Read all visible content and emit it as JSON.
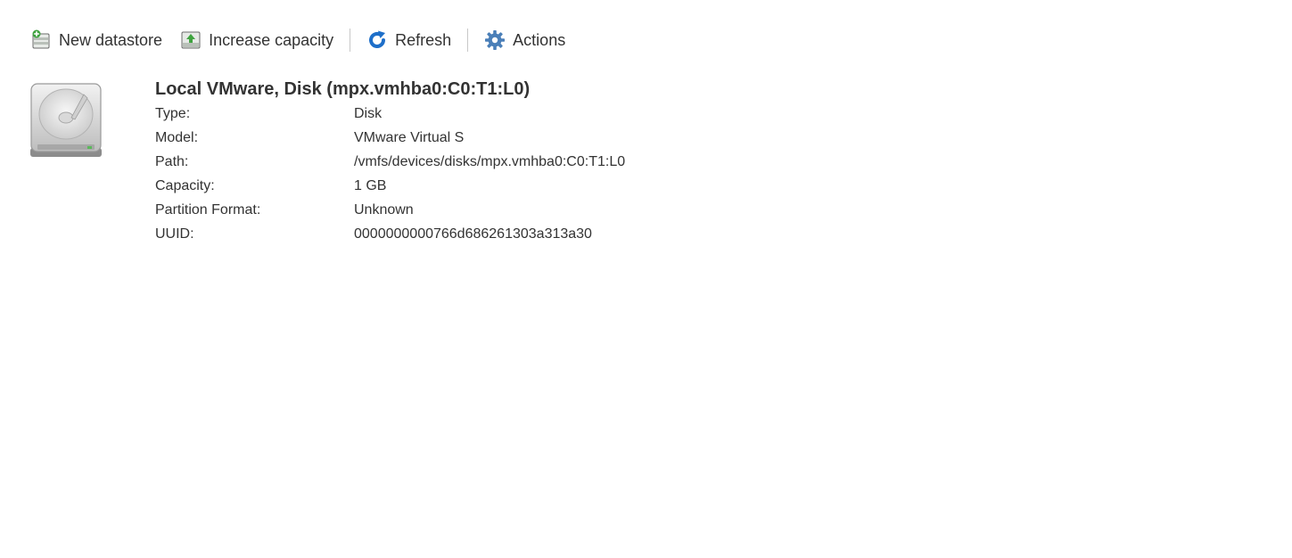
{
  "toolbar": {
    "new_datastore": {
      "label": "New datastore",
      "icon": "new-datastore-icon"
    },
    "increase_capacity": {
      "label": "Increase capacity",
      "icon": "increase-capacity-icon"
    },
    "refresh": {
      "label": "Refresh",
      "icon": "refresh-icon"
    },
    "actions": {
      "label": "Actions",
      "icon": "gear-icon"
    }
  },
  "device": {
    "icon": "hard-disk-icon",
    "title": "Local VMware, Disk (mpx.vmhba0:C0:T1:L0)",
    "properties": [
      {
        "label": "Type:",
        "value": "Disk"
      },
      {
        "label": "Model:",
        "value": "VMware Virtual S"
      },
      {
        "label": "Path:",
        "value": "/vmfs/devices/disks/mpx.vmhba0:C0:T1:L0"
      },
      {
        "label": "Capacity:",
        "value": "1 GB"
      },
      {
        "label": "Partition Format:",
        "value": "Unknown"
      },
      {
        "label": "UUID:",
        "value": "0000000000766d686261303a313a30"
      }
    ]
  },
  "colors": {
    "text": "#333333",
    "separator": "#c8c8c8",
    "refresh_blue": "#1e6fc9",
    "gear_blue": "#4a7fb8",
    "green_accent": "#3fa33f"
  }
}
